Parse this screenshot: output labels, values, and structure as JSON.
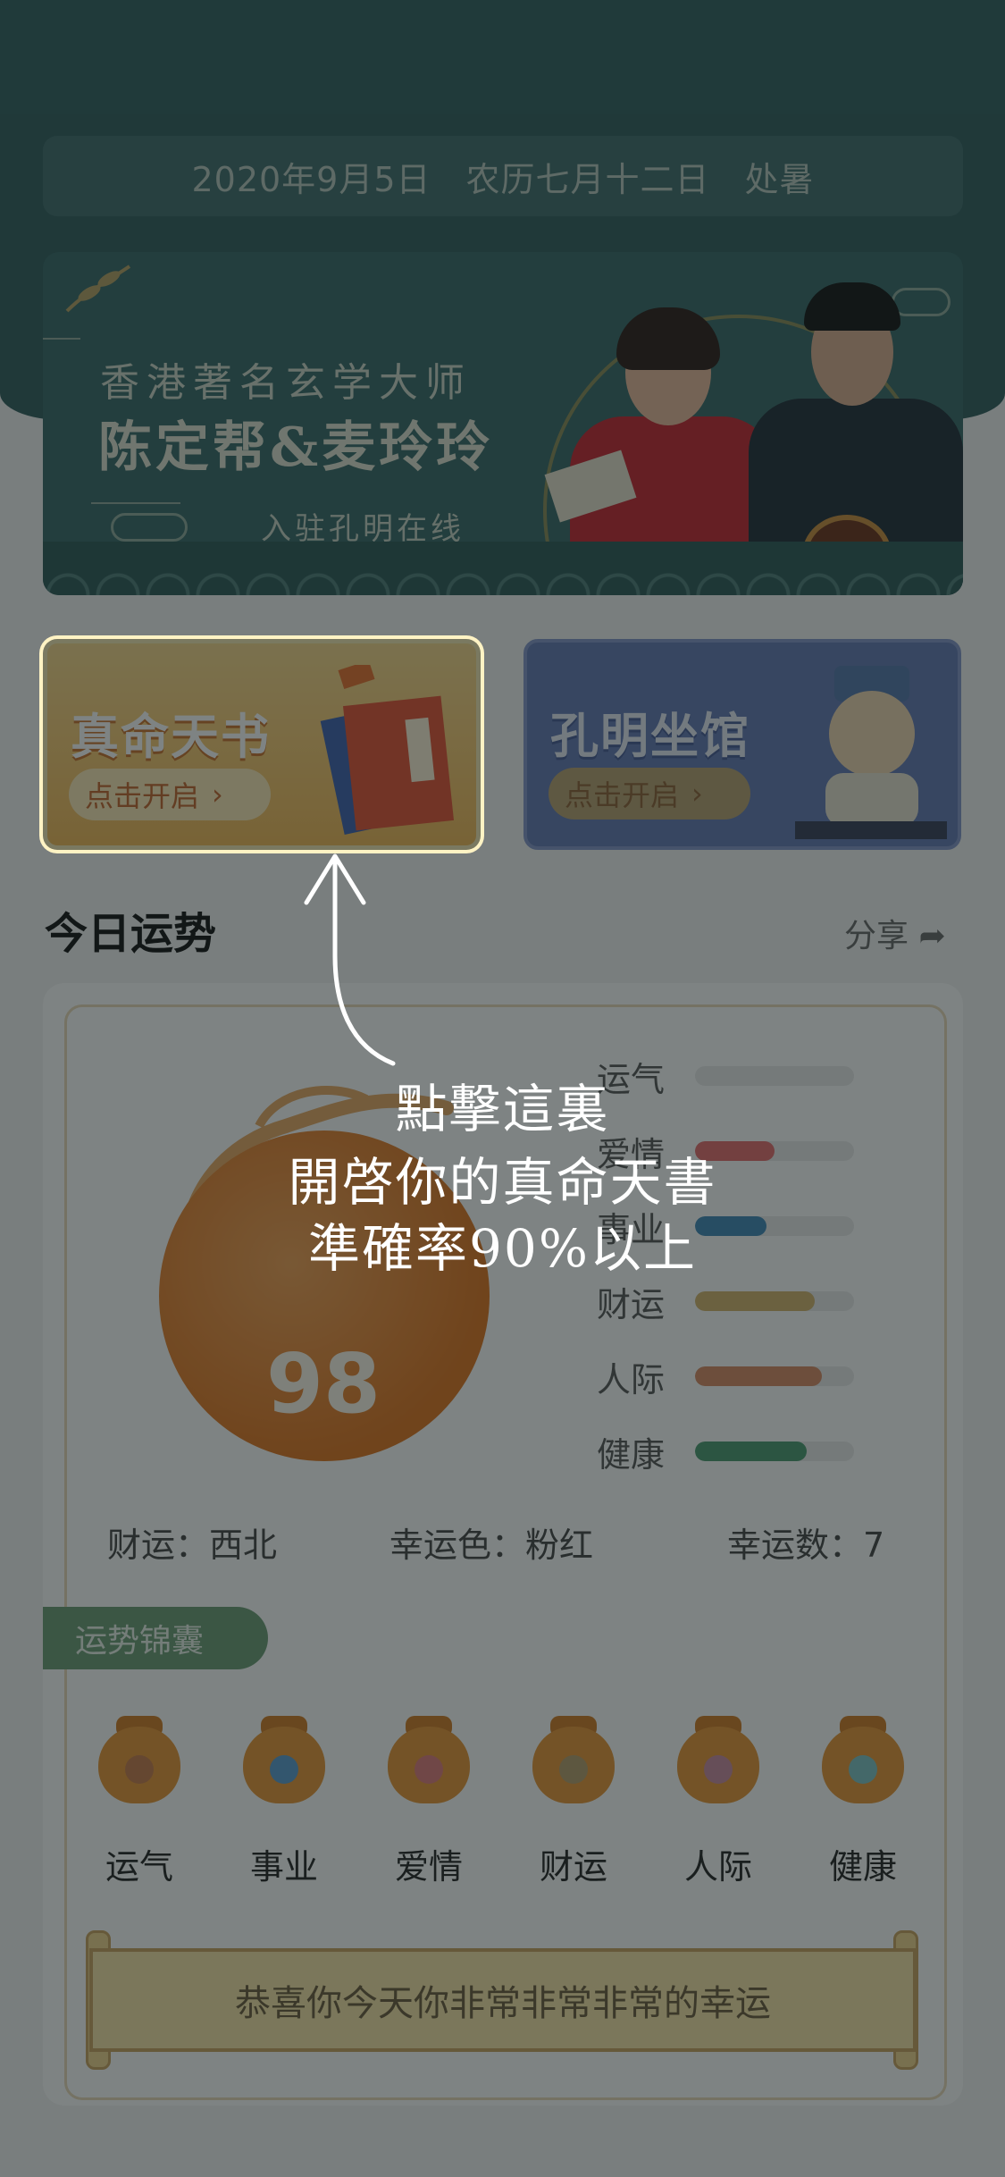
{
  "header": {
    "date_line": "2020年9月5日　农历七月十二日　处暑"
  },
  "banner": {
    "line1": "香港著名玄学大师",
    "line2": "陈定帮&麦玲玲",
    "line3": "入驻孔明在线"
  },
  "cards": [
    {
      "title": "真命天书",
      "button": "点击开启",
      "chevron": "›"
    },
    {
      "title": "孔明坐馆",
      "button": "点击开启",
      "chevron": "›"
    }
  ],
  "fortune": {
    "section_title": "今日运势",
    "share_label": "分享 ➦",
    "score": "98",
    "bars": [
      {
        "label": "运气",
        "value": 0.0,
        "color": "#c9c9c9"
      },
      {
        "label": "爱情",
        "value": 0.5,
        "color": "#e66b6b"
      },
      {
        "label": "事业",
        "value": 0.45,
        "color": "#3f88b8"
      },
      {
        "label": "财运",
        "value": 0.75,
        "color": "#d4b46a"
      },
      {
        "label": "人际",
        "value": 0.8,
        "color": "#d98a63"
      },
      {
        "label": "健康",
        "value": 0.7,
        "color": "#4a9a6f"
      }
    ],
    "facts": [
      "财运：西北",
      "幸运色：粉红",
      "幸运数：7"
    ],
    "tips_tag": "运势锦囊",
    "bags": [
      {
        "label": "运气",
        "emblem_color": "#c77b4a"
      },
      {
        "label": "事业",
        "emblem_color": "#5a9bd0"
      },
      {
        "label": "爱情",
        "emblem_color": "#e07a7a"
      },
      {
        "label": "财运",
        "emblem_color": "#b79d6c"
      },
      {
        "label": "人际",
        "emblem_color": "#c98aa0"
      },
      {
        "label": "健康",
        "emblem_color": "#7ec3c5"
      }
    ],
    "scroll_text": "恭喜你今天你非常非常非常的幸运"
  },
  "overlay": {
    "line1": "點擊這裏",
    "line2": "開啓你的真命天書",
    "line3": "準確率90%以上"
  }
}
